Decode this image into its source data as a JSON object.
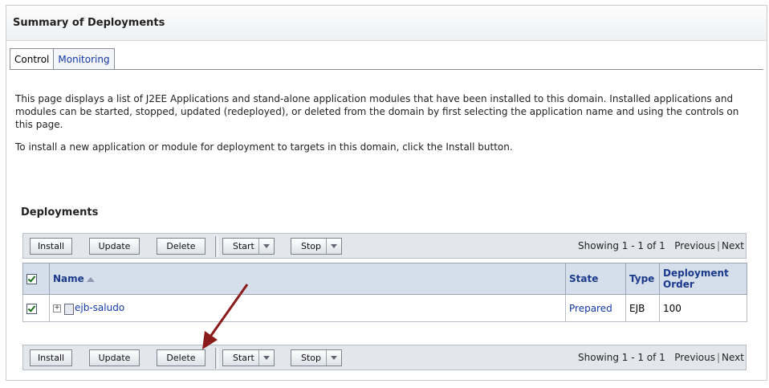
{
  "panel": {
    "title": "Summary of Deployments"
  },
  "tabs": [
    {
      "label": "Control"
    },
    {
      "label": "Monitoring"
    }
  ],
  "intro": {
    "p1": "This page displays a list of J2EE Applications and stand-alone application modules that have been installed to this domain. Installed applications and modules can be started, stopped, updated (redeployed), or deleted from the domain by first selecting the application name and using the controls on this page.",
    "p2": "To install a new application or module for deployment to targets in this domain, click the Install button."
  },
  "section": {
    "title": "Deployments"
  },
  "toolbar": {
    "install": "Install",
    "update": "Update",
    "delete": "Delete",
    "start": "Start",
    "stop": "Stop",
    "showing": "Showing 1 - 1 of 1",
    "previous": "Previous",
    "next": "Next"
  },
  "table": {
    "headers": {
      "name": "Name",
      "state": "State",
      "type": "Type",
      "order": "Deployment Order"
    },
    "rows": [
      {
        "name": "ejb-saludo",
        "state": "Prepared",
        "type": "EJB",
        "order": "100"
      }
    ]
  },
  "annotation": {
    "arrow_color": "#8b1a1a"
  }
}
